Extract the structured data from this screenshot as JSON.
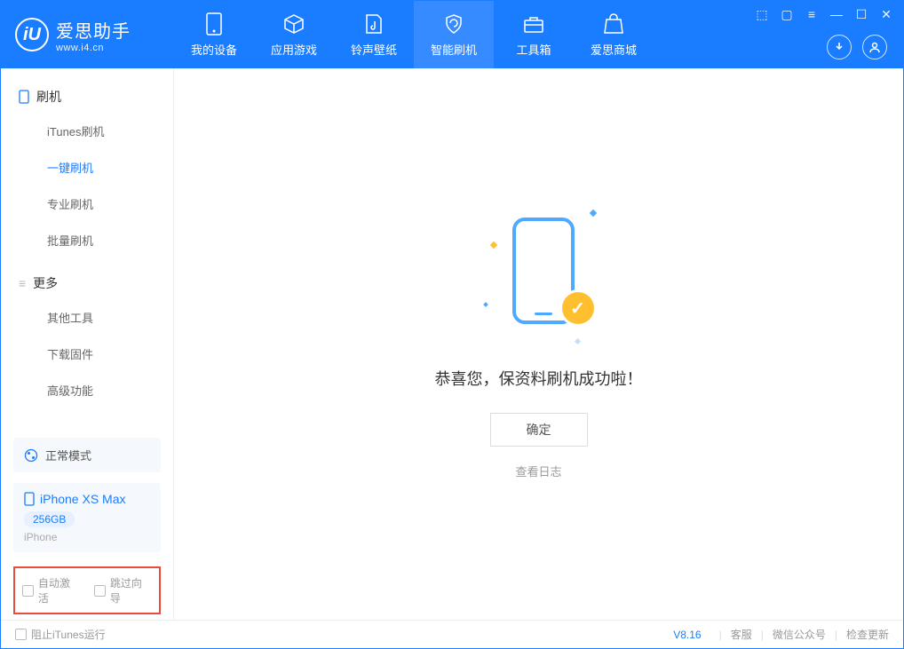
{
  "logo": {
    "title": "爱思助手",
    "sub": "www.i4.cn",
    "mark": "iU"
  },
  "nav": [
    {
      "label": "我的设备"
    },
    {
      "label": "应用游戏"
    },
    {
      "label": "铃声壁纸"
    },
    {
      "label": "智能刷机"
    },
    {
      "label": "工具箱"
    },
    {
      "label": "爱思商城"
    }
  ],
  "sidebar": {
    "group1": {
      "title": "刷机",
      "items": [
        "iTunes刷机",
        "一键刷机",
        "专业刷机",
        "批量刷机"
      ]
    },
    "group2": {
      "title": "更多",
      "items": [
        "其他工具",
        "下载固件",
        "高级功能"
      ]
    }
  },
  "mode_card": {
    "label": "正常模式"
  },
  "device": {
    "name": "iPhone XS Max",
    "capacity": "256GB",
    "type": "iPhone"
  },
  "checkboxes": {
    "auto_activate": "自动激活",
    "skip_guide": "跳过向导"
  },
  "main": {
    "success_message": "恭喜您，保资料刷机成功啦！",
    "confirm_label": "确定",
    "view_log_label": "查看日志"
  },
  "footer": {
    "block_itunes": "阻止iTunes运行",
    "version": "V8.16",
    "links": [
      "客服",
      "微信公众号",
      "检查更新"
    ]
  }
}
